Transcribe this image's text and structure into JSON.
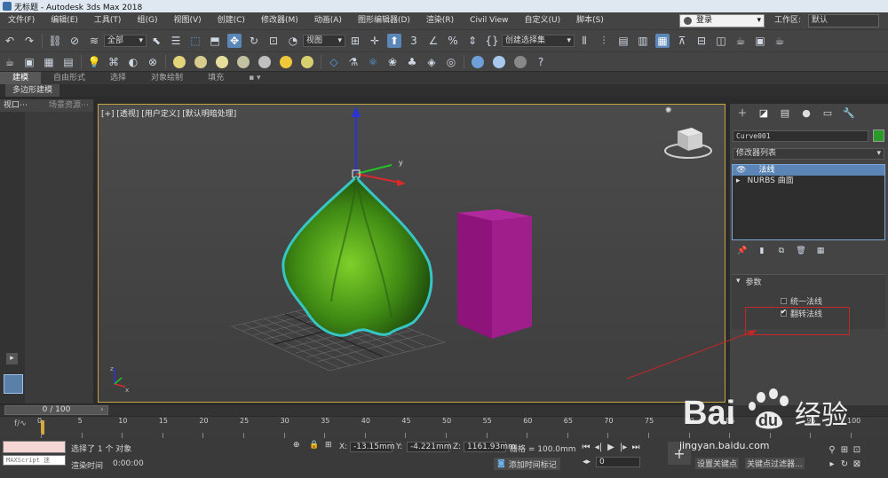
{
  "window": {
    "title": "无标题 - Autodesk 3ds Max 2018"
  },
  "menubar": {
    "items": [
      "文件(F)",
      "编辑(E)",
      "工具(T)",
      "组(G)",
      "视图(V)",
      "创建(C)",
      "修改器(M)",
      "动画(A)",
      "图形编辑器(D)",
      "渲染(R)",
      "Civil View",
      "自定义(U)",
      "脚本(S)"
    ],
    "login": "登录",
    "workspace_label": "工作区:",
    "workspace_value": "默认"
  },
  "toolbar1": {
    "selection_filter": "全部",
    "ref_coord": "视图",
    "named_selection": "创建选择集"
  },
  "ribbon": {
    "tabs": [
      "建模",
      "自由形式",
      "选择",
      "对象绘制",
      "填充"
    ],
    "active": "建模",
    "sub_tab": "多边形建模"
  },
  "left_panel": {
    "tab1": "视口⋯",
    "tab2": "场景资源⋯"
  },
  "viewport": {
    "label": "[+] [透视] [用户定义] [默认明暗处理]",
    "axis_x": "x",
    "axis_y": "y",
    "axis_z": "z"
  },
  "command_panel": {
    "object_name": "Curve001",
    "object_color": "#2a9a2a",
    "modifier_list": "修改器列表",
    "stack": [
      {
        "label": "法线",
        "selected": true
      },
      {
        "label": "NURBS 曲面",
        "selected": false
      }
    ],
    "params_title": "参数",
    "options": [
      {
        "label": "统一法线",
        "checked": false
      },
      {
        "label": "翻转法线",
        "checked": true
      }
    ]
  },
  "timeline": {
    "frame": "0 / 100",
    "ticks": [
      "0",
      "5",
      "10",
      "15",
      "20",
      "25",
      "30",
      "35",
      "40",
      "45",
      "50",
      "55",
      "60",
      "65",
      "70",
      "75",
      "80",
      "85",
      "90",
      "95",
      "100"
    ]
  },
  "status": {
    "maxscript_label": "MAXScript 迷",
    "selection_text": "选择了 1 个 对象",
    "render_time_label": "渲染时间",
    "render_time": "0:00:00",
    "x_label": "X:",
    "x_value": "-13.15mm",
    "y_label": "Y:",
    "y_value": "-4.221mm",
    "z_label": "Z:",
    "z_value": "1161.93mm",
    "grid_label": "栅格 = 100.0mm",
    "add_time_tag": "添加时间标记",
    "frame_field": "0",
    "set_key_label": "设置关键点",
    "key_filter_label": "关键点过滤器..."
  },
  "watermark": {
    "brand_bai": "Bai",
    "brand_du": "du",
    "brand_cn": "经验",
    "url": "jingyan.baidu.com"
  },
  "colors": {
    "accent_blue": "#5b85b6",
    "viewport_border": "#c9a640",
    "highlight_red": "#c62626",
    "box_magenta": "#9c1a88",
    "mesh_green": "#4a9a1a",
    "outline_cyan": "#37c6c6"
  }
}
